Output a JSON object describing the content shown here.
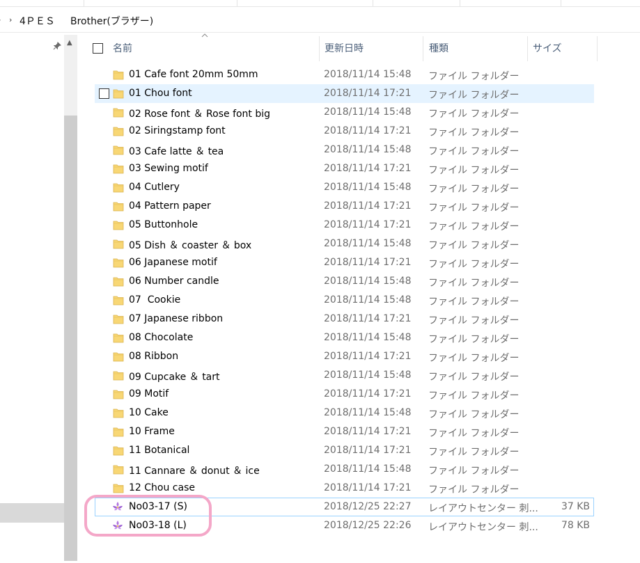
{
  "ribbon": {
    "tab_labels": [
      "",
      "",
      "",
      "",
      ""
    ]
  },
  "address_bar": {
    "path": [
      "4ＰＥＳ",
      "Brother(ブラザー)"
    ]
  },
  "columns": {
    "name": "名前",
    "modified": "更新日時",
    "type": "種類",
    "size": "サイズ"
  },
  "files": [
    {
      "name": "01 Cafe font 20mm 50mm",
      "modified": "2018/11/14 15:48",
      "type": "ファイル フォルダー",
      "size": "",
      "icon": "folder-icon"
    },
    {
      "name": "01 Chou font",
      "modified": "2018/11/14 17:21",
      "type": "ファイル フォルダー",
      "size": "",
      "icon": "folder-icon"
    },
    {
      "name": "02 Rose font ＆ Rose font big",
      "modified": "2018/11/14 15:48",
      "type": "ファイル フォルダー",
      "size": "",
      "icon": "folder-icon"
    },
    {
      "name": "02 Siringstamp font",
      "modified": "2018/11/14 17:21",
      "type": "ファイル フォルダー",
      "size": "",
      "icon": "folder-icon"
    },
    {
      "name": "03 Cafe latte ＆ tea",
      "modified": "2018/11/14 15:48",
      "type": "ファイル フォルダー",
      "size": "",
      "icon": "folder-icon"
    },
    {
      "name": "03 Sewing motif",
      "modified": "2018/11/14 17:21",
      "type": "ファイル フォルダー",
      "size": "",
      "icon": "folder-icon"
    },
    {
      "name": "04 Cutlery",
      "modified": "2018/11/14 15:48",
      "type": "ファイル フォルダー",
      "size": "",
      "icon": "folder-icon"
    },
    {
      "name": "04 Pattern paper",
      "modified": "2018/11/14 17:21",
      "type": "ファイル フォルダー",
      "size": "",
      "icon": "folder-icon"
    },
    {
      "name": "05 Buttonhole",
      "modified": "2018/11/14 17:21",
      "type": "ファイル フォルダー",
      "size": "",
      "icon": "folder-icon"
    },
    {
      "name": "05 Dish ＆ coaster ＆ box",
      "modified": "2018/11/14 15:48",
      "type": "ファイル フォルダー",
      "size": "",
      "icon": "folder-icon"
    },
    {
      "name": "06 Japanese motif",
      "modified": "2018/11/14 17:21",
      "type": "ファイル フォルダー",
      "size": "",
      "icon": "folder-icon"
    },
    {
      "name": "06 Number candle",
      "modified": "2018/11/14 15:48",
      "type": "ファイル フォルダー",
      "size": "",
      "icon": "folder-icon"
    },
    {
      "name": "07  Cookie",
      "modified": "2018/11/14 15:48",
      "type": "ファイル フォルダー",
      "size": "",
      "icon": "folder-icon"
    },
    {
      "name": "07 Japanese ribbon",
      "modified": "2018/11/14 17:21",
      "type": "ファイル フォルダー",
      "size": "",
      "icon": "folder-icon"
    },
    {
      "name": "08 Chocolate",
      "modified": "2018/11/14 15:48",
      "type": "ファイル フォルダー",
      "size": "",
      "icon": "folder-icon"
    },
    {
      "name": "08 Ribbon",
      "modified": "2018/11/14 17:21",
      "type": "ファイル フォルダー",
      "size": "",
      "icon": "folder-icon"
    },
    {
      "name": "09 Cupcake ＆ tart",
      "modified": "2018/11/14 15:48",
      "type": "ファイル フォルダー",
      "size": "",
      "icon": "folder-icon"
    },
    {
      "name": "09 Motif",
      "modified": "2018/11/14 17:21",
      "type": "ファイル フォルダー",
      "size": "",
      "icon": "folder-icon"
    },
    {
      "name": "10 Cake",
      "modified": "2018/11/14 15:48",
      "type": "ファイル フォルダー",
      "size": "",
      "icon": "folder-icon"
    },
    {
      "name": "10 Frame",
      "modified": "2018/11/14 17:21",
      "type": "ファイル フォルダー",
      "size": "",
      "icon": "folder-icon"
    },
    {
      "name": "11 Botanical",
      "modified": "2018/11/14 17:21",
      "type": "ファイル フォルダー",
      "size": "",
      "icon": "folder-icon"
    },
    {
      "name": "11 Cannare ＆ donut ＆ ice",
      "modified": "2018/11/14 15:48",
      "type": "ファイル フォルダー",
      "size": "",
      "icon": "folder-icon"
    },
    {
      "name": "12 Chou case",
      "modified": "2018/11/14 17:21",
      "type": "ファイル フォルダー",
      "size": "",
      "icon": "folder-icon"
    },
    {
      "name": "No03-17 (S)",
      "modified": "2018/12/25 22:27",
      "type": "レイアウトセンター 刺...",
      "size": "37 KB",
      "icon": "embroidery-file-icon"
    },
    {
      "name": "No03-18 (L)",
      "modified": "2018/12/25 22:26",
      "type": "レイアウトセンター 刺...",
      "size": "78 KB",
      "icon": "embroidery-file-icon"
    }
  ],
  "hovered_row_index": 1,
  "outlined_row_index": 23,
  "colors": {
    "hover_bg": "#e5f3ff",
    "focus_outline": "#99d1ff",
    "highlight_ring": "#f4a7c8",
    "folder_yellow": "#f8d775"
  }
}
